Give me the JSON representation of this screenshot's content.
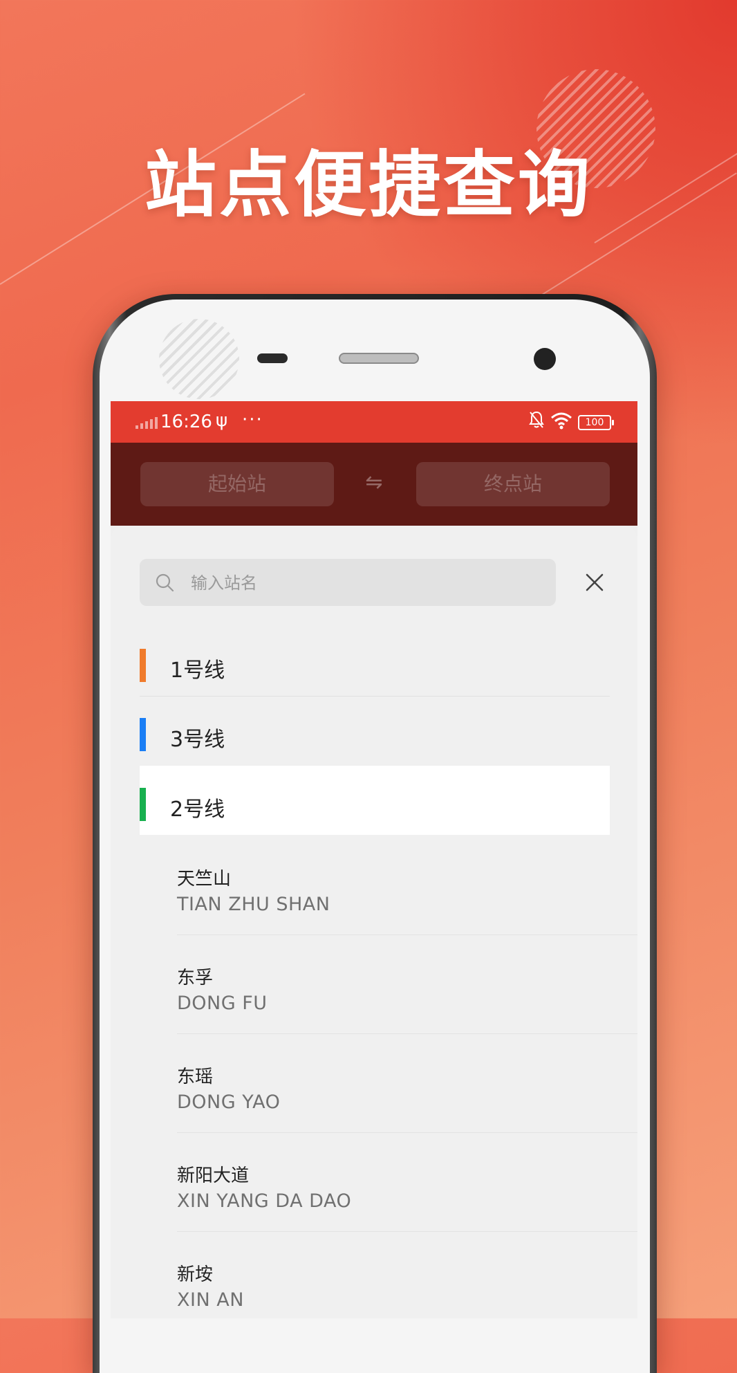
{
  "headline": "站点便捷查询",
  "status_bar": {
    "time": "16:26",
    "usb_symbol": "ψ",
    "more": "···",
    "battery": "100"
  },
  "route_bar": {
    "start_placeholder": "起始站",
    "swap_symbol": "⇋",
    "end_placeholder": "终点站"
  },
  "search": {
    "placeholder": "输入站名"
  },
  "lines": [
    {
      "label": "1号线",
      "color": "#f07b2c"
    },
    {
      "label": "3号线",
      "color": "#1a7ef5"
    },
    {
      "label": "2号线",
      "color": "#18b04f",
      "selected": true
    }
  ],
  "stations": [
    {
      "name": "天竺山",
      "pinyin": "TIAN ZHU SHAN"
    },
    {
      "name": "东孚",
      "pinyin": "DONG FU"
    },
    {
      "name": "东瑶",
      "pinyin": "DONG YAO"
    },
    {
      "name": "新阳大道",
      "pinyin": "XIN YANG DA DAO"
    },
    {
      "name": "新垵",
      "pinyin": "XIN AN"
    }
  ],
  "colors": {
    "status_bar": "#e33c2f",
    "route_bar": "#5e1a15",
    "sheet": "#f0f0f0",
    "brand_gradient_start": "#e23a2e",
    "brand_gradient_end": "#f6a07a"
  }
}
